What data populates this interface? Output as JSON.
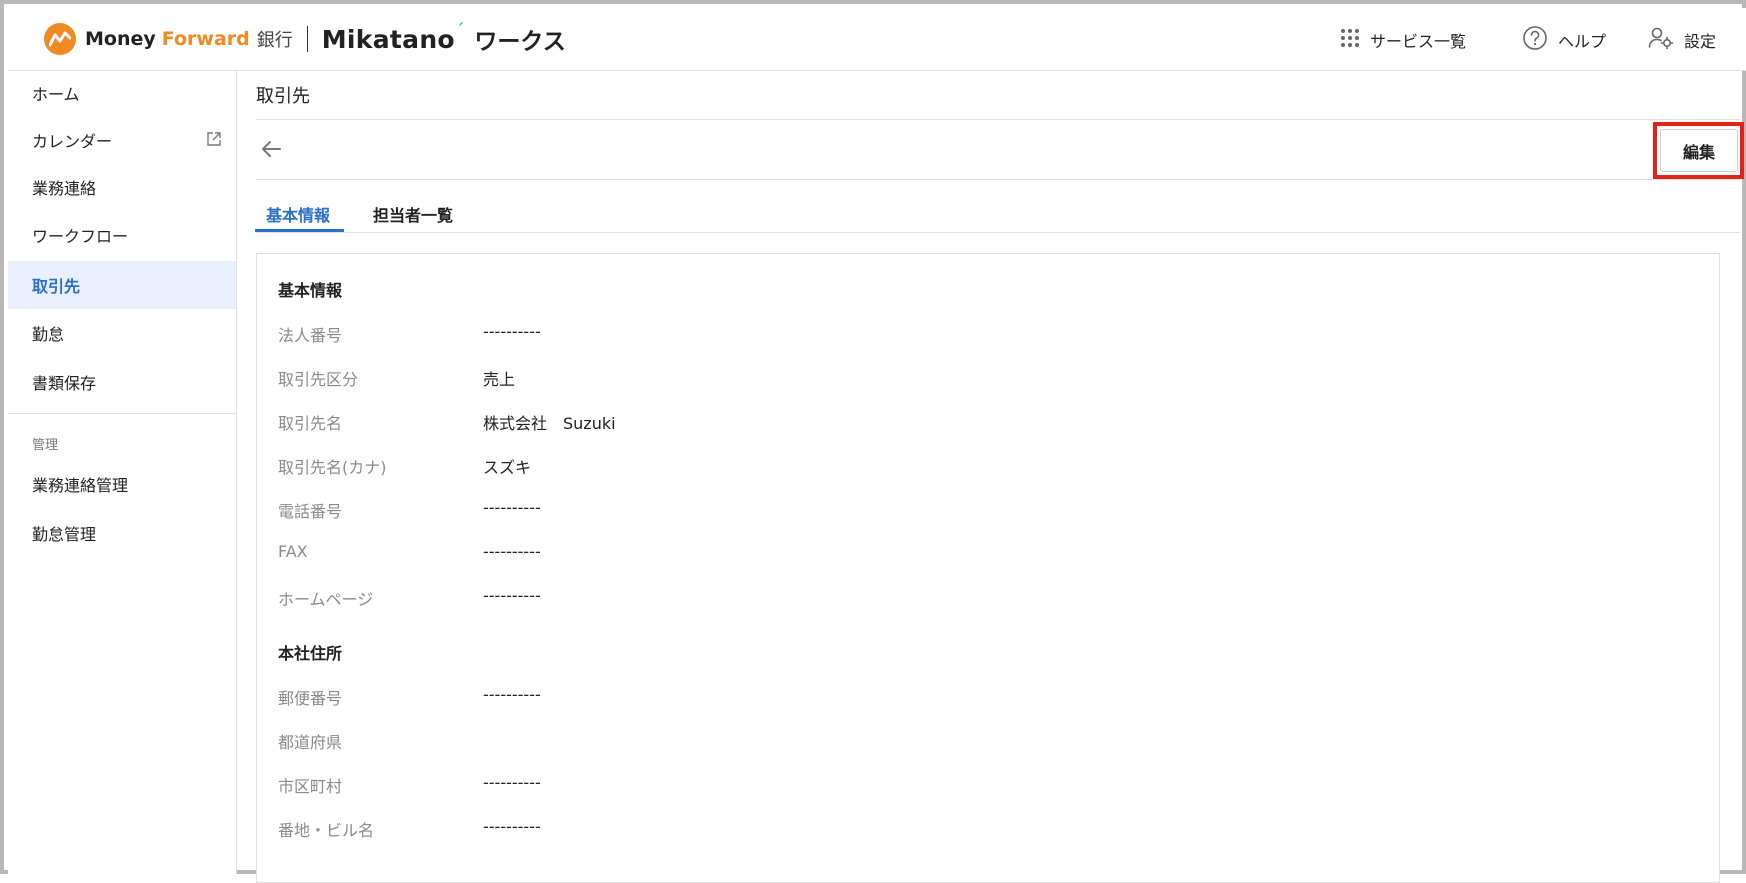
{
  "header": {
    "brand": {
      "money": "Money",
      "forward": "Forward",
      "bank": "銀行",
      "mikatano": "Mikatano",
      "accent": "ˊ",
      "works": "ワークス"
    },
    "services_label": "サービス一覧",
    "help_label": "ヘルプ",
    "settings_label": "設定"
  },
  "sidebar": {
    "items": [
      {
        "label": "ホーム"
      },
      {
        "label": "カレンダー"
      },
      {
        "label": "業務連絡"
      },
      {
        "label": "ワークフロー"
      },
      {
        "label": "取引先"
      },
      {
        "label": "勤怠"
      },
      {
        "label": "書類保存"
      }
    ],
    "admin_section": "管理",
    "admin_items": [
      {
        "label": "業務連絡管理"
      },
      {
        "label": "勤怠管理"
      }
    ]
  },
  "page": {
    "title": "取引先",
    "edit_label": "編集",
    "tabs": [
      {
        "label": "基本情報"
      },
      {
        "label": "担当者一覧"
      }
    ]
  },
  "basic_info": {
    "heading": "基本情報",
    "fields": [
      {
        "label": "法人番号",
        "value": "----------"
      },
      {
        "label": "取引先区分",
        "value": "売上"
      },
      {
        "label": "取引先名",
        "value": "株式会社　Suzuki"
      },
      {
        "label": "取引先名(カナ)",
        "value": "スズキ"
      },
      {
        "label": "電話番号",
        "value": "----------"
      },
      {
        "label": "FAX",
        "value": "----------"
      },
      {
        "label": "ホームページ",
        "value": "----------"
      }
    ]
  },
  "address": {
    "heading": "本社住所",
    "fields": [
      {
        "label": "郵便番号",
        "value": "----------"
      },
      {
        "label": "都道府県",
        "value": ""
      },
      {
        "label": "市区町村",
        "value": "----------"
      },
      {
        "label": "番地・ビル名",
        "value": "----------"
      }
    ]
  },
  "colors": {
    "accent": "#2b6fc7",
    "brand_orange": "#f08a24",
    "highlight": "#e2231a",
    "active_bg": "#e9f0fb"
  },
  "icons": {
    "services": "grid-dots-icon",
    "help": "question-circle-icon",
    "settings": "user-gear-icon",
    "external": "external-link-icon",
    "back": "arrow-left-icon"
  }
}
